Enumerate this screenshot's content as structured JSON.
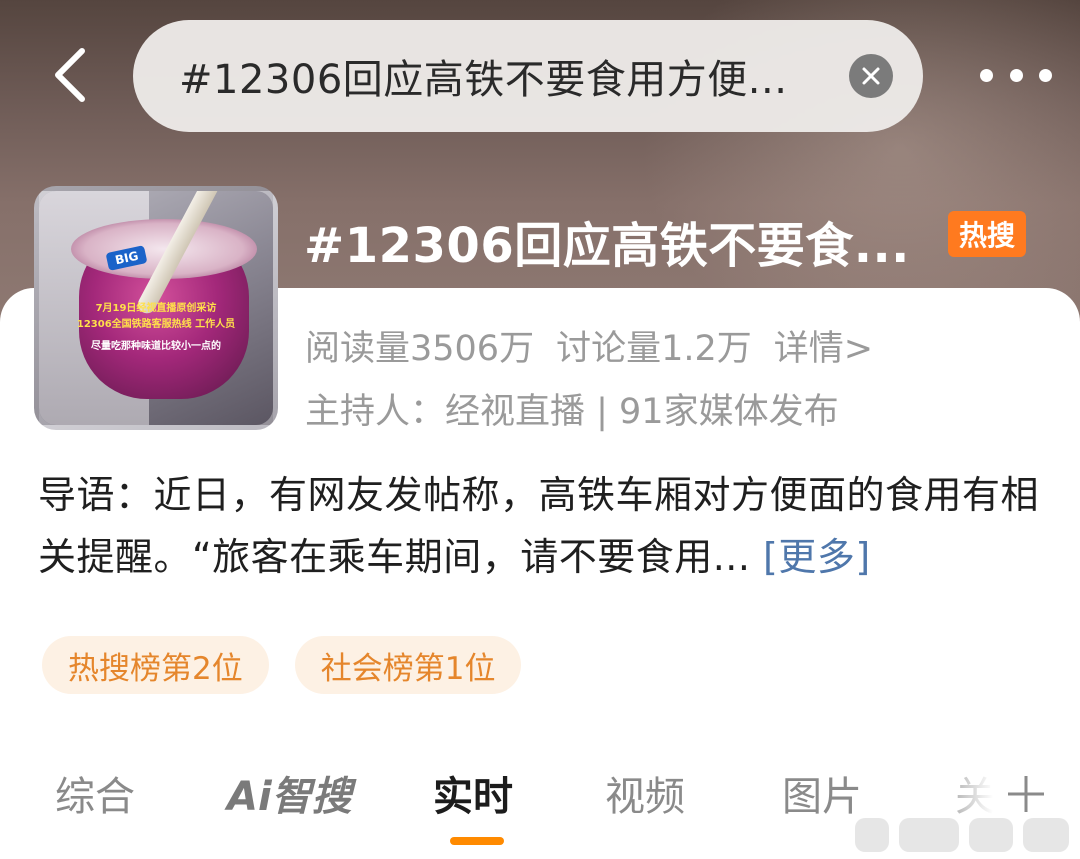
{
  "search": {
    "query": "#12306回应高铁不要食用方便..."
  },
  "topic": {
    "title": "#12306回应高铁不要食...",
    "hot_badge": "热搜",
    "thumbnail": {
      "big_label": "BIG",
      "caption_line1": "7月19日经视直播原创采访",
      "caption_line2": "12306全国铁路客服热线 工作人员",
      "caption_line3": "尽量吃那种味道比较小一点的"
    },
    "reads": "阅读量3506万",
    "discussions": "讨论量1.2万",
    "details_link": "详情>",
    "host_line": "主持人：经视直播 | 91家媒体发布",
    "intro": "导语：近日，有网友发帖称，高铁车厢对方便面的食用有相关提醒。“旅客在乘车期间，请不要食用...",
    "more_link": "[更多]"
  },
  "tags": [
    {
      "label": "热搜榜第2位"
    },
    {
      "label": "社会榜第1位"
    }
  ],
  "tabs": [
    {
      "label": "综合"
    },
    {
      "label": "Ai智搜"
    },
    {
      "label": "实时"
    },
    {
      "label": "视频"
    },
    {
      "label": "图片"
    },
    {
      "label": "关"
    }
  ],
  "active_tab": "实时",
  "colors": {
    "accent": "#ff8a00",
    "hot_badge": "#ff7a1f",
    "tag_bg": "#fdf1e4",
    "tag_text": "#e5862c",
    "link": "#4f77ab"
  },
  "icons": [
    "back-arrow-icon",
    "clear-icon",
    "more-dots-icon",
    "plus-icon"
  ]
}
